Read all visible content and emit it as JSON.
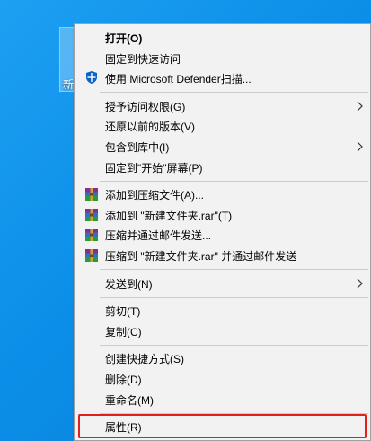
{
  "desktop": {
    "icon_label": "新"
  },
  "menu": {
    "groups": [
      [
        {
          "label": "打开(O)",
          "bold": true
        },
        {
          "label": "固定到快速访问"
        },
        {
          "label": "使用 Microsoft Defender扫描...",
          "icon": "defender-shield-icon"
        }
      ],
      [
        {
          "label": "授予访问权限(G)",
          "submenu": true
        },
        {
          "label": "还原以前的版本(V)"
        },
        {
          "label": "包含到库中(I)",
          "submenu": true
        },
        {
          "label": "固定到\"开始\"屏幕(P)"
        }
      ],
      [
        {
          "label": "添加到压缩文件(A)...",
          "icon": "winrar-icon"
        },
        {
          "label": "添加到 \"新建文件夹.rar\"(T)",
          "icon": "winrar-icon"
        },
        {
          "label": "压缩并通过邮件发送...",
          "icon": "winrar-icon"
        },
        {
          "label": "压缩到 \"新建文件夹.rar\" 并通过邮件发送",
          "icon": "winrar-icon"
        }
      ],
      [
        {
          "label": "发送到(N)",
          "submenu": true
        }
      ],
      [
        {
          "label": "剪切(T)"
        },
        {
          "label": "复制(C)"
        }
      ],
      [
        {
          "label": "创建快捷方式(S)"
        },
        {
          "label": "删除(D)"
        },
        {
          "label": "重命名(M)"
        }
      ],
      [
        {
          "label": "属性(R)",
          "highlighted": true
        }
      ]
    ]
  },
  "colors": {
    "highlight_border": "#e0201a",
    "defender_blue": "#0a63c9"
  }
}
